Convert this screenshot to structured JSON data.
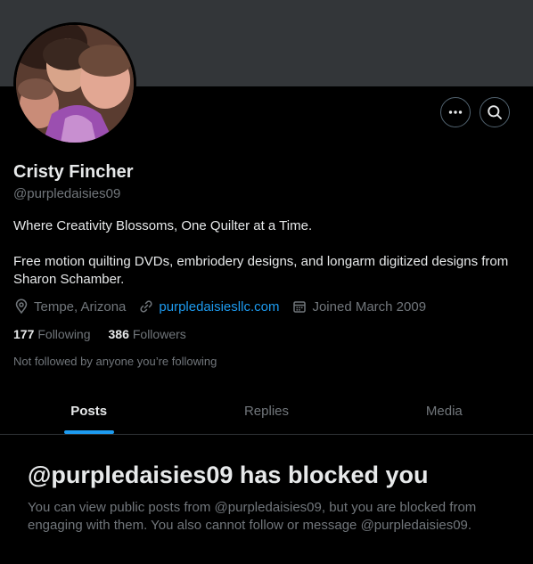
{
  "profile": {
    "name": "Cristy Fincher",
    "handle": "@purpledaisies09",
    "bio_line1": "Where Creativity Blossoms, One Quilter at a Time.",
    "bio_line2": "Free motion quilting DVDs, embriodery designs, and longarm digitized designs from Sharon Schamber.",
    "location": "Tempe, Arizona",
    "website": "purpledaisiesllc.com",
    "joined": "Joined March 2009",
    "following_count": "177",
    "following_label": "Following",
    "followers_count": "386",
    "followers_label": "Followers",
    "not_followed_note": "Not followed by anyone you’re following"
  },
  "actions": {
    "more_icon": "more-horizontal-icon",
    "search_icon": "search-icon"
  },
  "tabs": [
    {
      "label": "Posts",
      "active": true
    },
    {
      "label": "Replies",
      "active": false
    },
    {
      "label": "Media",
      "active": false
    }
  ],
  "blocked": {
    "title": "@purpledaisies09 has blocked you",
    "message": "You can view public posts from @purpledaisies09, but you are blocked from engaging with them. You also cannot follow or message @purpledaisies09."
  },
  "colors": {
    "background": "#000000",
    "banner": "#333639",
    "accent": "#1d9bf0",
    "text_primary": "#e7e9ea",
    "text_secondary": "#71767b",
    "border": "#2f3336"
  }
}
